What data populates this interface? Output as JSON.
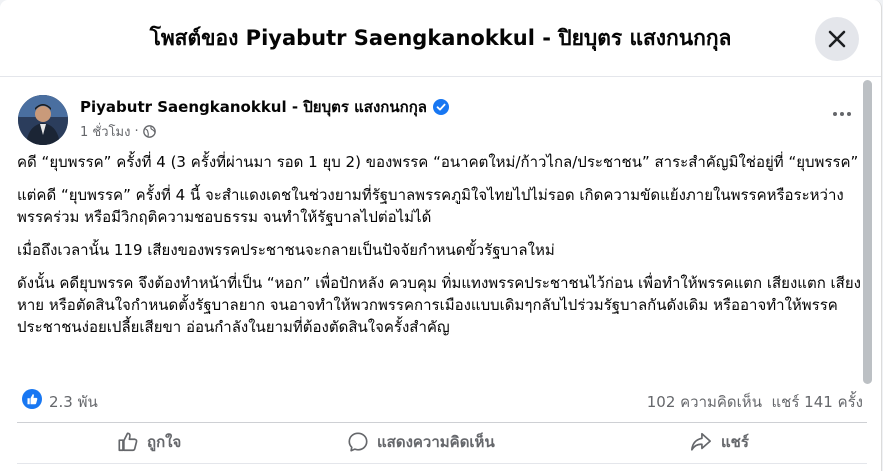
{
  "dialog": {
    "title": "โพสต์ของ Piyabutr Saengkanokkul - ปิยบุตร แสงกนกกุล",
    "close_icon": "close-icon"
  },
  "post": {
    "author": "Piyabutr Saengkanokkul - ปิยบุตร แสงกนกกุล",
    "time": "1 ชั่วโมง",
    "separator": "·",
    "privacy_icon": "globe-icon",
    "paragraphs": [
      "คดี “ยุบพรรค” ครั้งที่ 4 (3 ครั้งที่ผ่านมา รอด 1 ยุบ 2) ของพรรค “อนาคตใหม่/ก้าวไกล/ประชาชน” สาระสำคัญมิใช่อยู่ที่ “ยุบพรรค”",
      "แต่คดี “ยุบพรรค” ครั้งที่ 4 นี้ จะสำแดงเดชในช่วงยามที่รัฐบาลพรรคภูมิใจไทยไปไม่รอด เกิดความขัดแย้งภายในพรรคหรือระหว่างพรรคร่วม หรือมีวิกฤติความชอบธรรม จนทำให้รัฐบาลไปต่อไม่ได้",
      "เมื่อถึงเวลานั้น 119 เสียงของพรรคประชาชนจะกลายเป็นปัจจัยกำหนดขั้วรัฐบาลใหม่",
      "ดังนั้น คดียุบพรรค จึงต้องทำหน้าที่เป็น “หอก” เพื่อปักหลัง ควบคุม ทิ่มแทงพรรคประชาชนไว้ก่อน เพื่อทำให้พรรคแตก เสียงแตก เสียงหาย หรือตัดสินใจกำหนดตั้งรัฐบาลยาก จนอาจทำให้พวกพรรคการเมืองแบบเดิมๆกลับไปร่วมรัฐบาลกันดังเดิม หรืออาจทำให้พรรคประชาชนง่อยเปลี้ยเสียขา อ่อนกำลังในยามที่ต้องตัดสินใจครั้งสำคัญ"
    ]
  },
  "stats": {
    "likes": "2.3 พัน",
    "comments": "102 ความคิดเห็น",
    "shares": "แชร์ 141 ครั้ง"
  },
  "actions": {
    "like": "ถูกใจ",
    "comment": "แสดงความคิดเห็น",
    "share": "แชร์"
  },
  "colors": {
    "accent": "#1877f2",
    "secondary_text": "#65676b"
  }
}
